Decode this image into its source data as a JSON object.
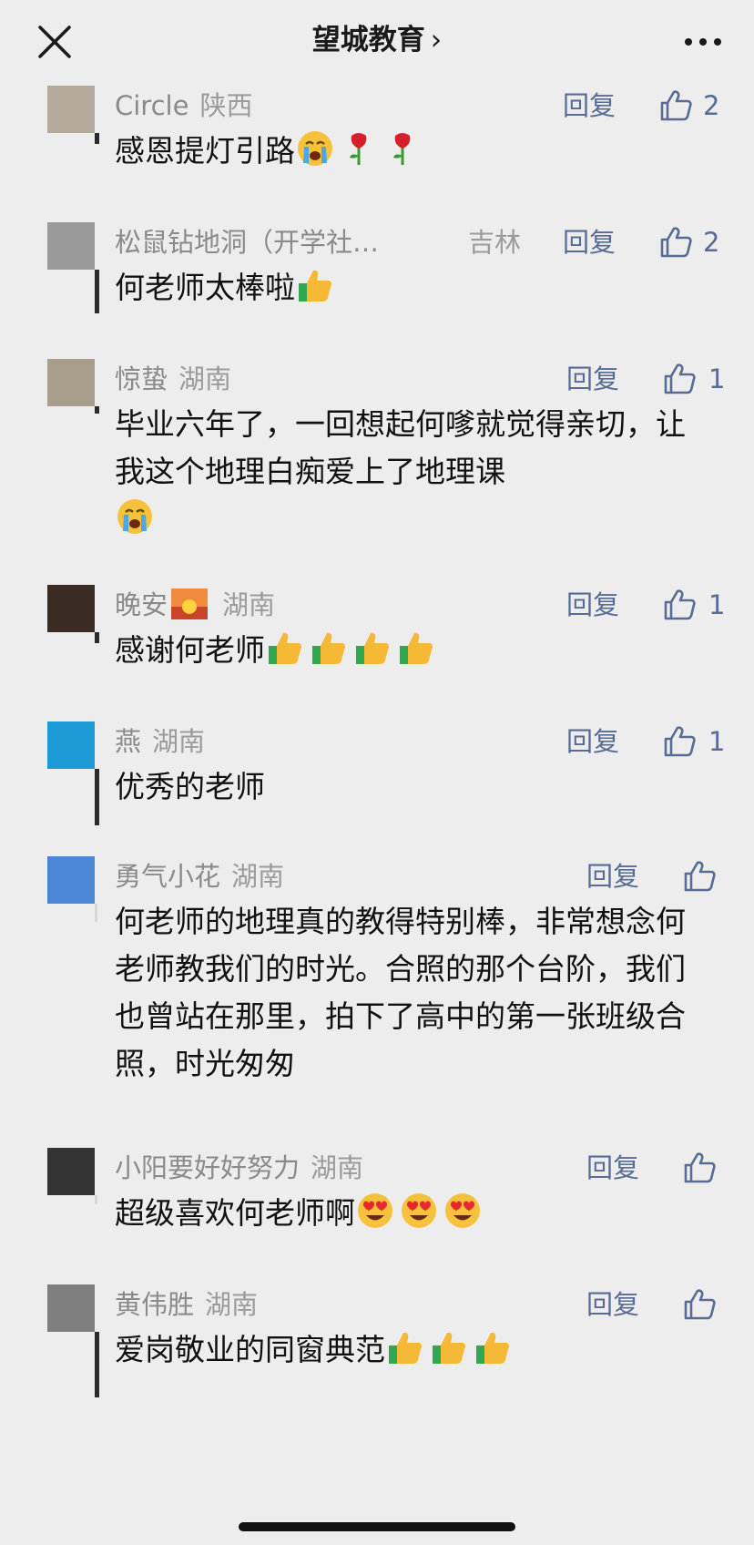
{
  "header": {
    "title": "望城教育",
    "title_chevron": "›"
  },
  "comments": [
    {
      "name": "Circle",
      "location": "陕西",
      "text": "感恩提灯引路",
      "reply": "回复",
      "likes": "2"
    },
    {
      "name": "松鼠钻地洞（开学社…",
      "location": "吉林",
      "text": "何老师太棒啦",
      "reply": "回复",
      "likes": "2"
    },
    {
      "name": "惊蛰",
      "location": "湖南",
      "text": "毕业六年了，一回想起何嗲就觉得亲切，让我这个地理白痴爱上了地理课",
      "reply": "回复",
      "likes": "1"
    },
    {
      "name": "晚安",
      "location": "湖南",
      "text": "感谢何老师",
      "reply": "回复",
      "likes": "1"
    },
    {
      "name": "燕",
      "location": "湖南",
      "text": "优秀的老师",
      "reply": "回复",
      "likes": "1"
    },
    {
      "name": "勇气小花",
      "location": "湖南",
      "text": "何老师的地理真的教得特别棒，非常想念何老师教我们的时光。合照的那个台阶，我们也曾站在那里，拍下了高中的第一张班级合照，时光匆匆",
      "reply": "回复",
      "likes": ""
    },
    {
      "name": "小阳要好好努力",
      "location": "湖南",
      "text": "超级喜欢何老师啊",
      "reply": "回复",
      "likes": ""
    },
    {
      "name": "黄伟胜",
      "location": "湖南",
      "text": "爱岗敬业的同窗典范",
      "reply": "回复",
      "likes": ""
    }
  ],
  "icons": {
    "close": "close-icon",
    "more": "more-icon",
    "like": "thumbs-up-outline-icon",
    "emoji_cry": "loudly-crying-face-emoji",
    "emoji_rose": "rose-emoji",
    "emoji_thumb": "thumbs-up-emoji",
    "emoji_sunset": "sunset-emoji",
    "emoji_heart_eyes": "heart-eyes-emoji"
  },
  "colors": {
    "background": "#ededed",
    "link": "#576b95",
    "meta": "#8a8a8a"
  }
}
